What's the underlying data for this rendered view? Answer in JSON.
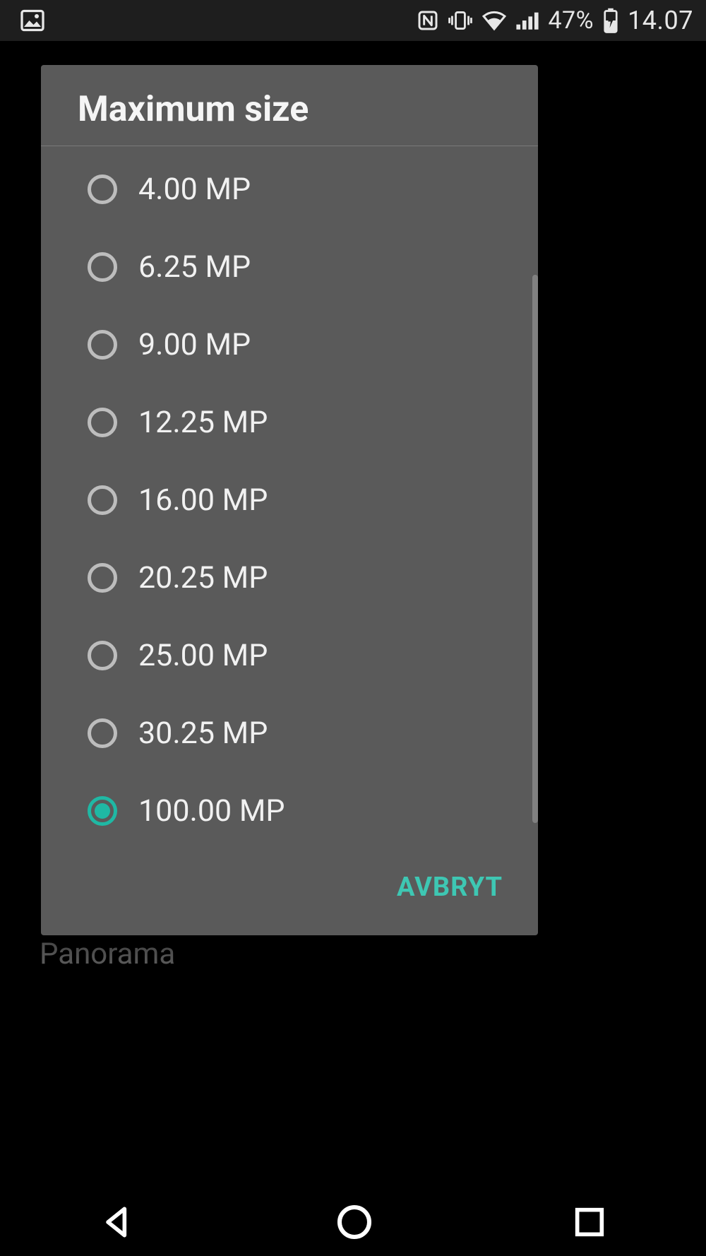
{
  "status_bar": {
    "battery_pct": "47%",
    "clock": "14.07",
    "icons": [
      "picture",
      "nfc",
      "vibrate",
      "wifi",
      "signal",
      "battery-charging"
    ]
  },
  "background": {
    "list_item_visible": "Panorama"
  },
  "dialog": {
    "title": "Maximum size",
    "options": [
      {
        "label": "4.00 MP",
        "selected": false
      },
      {
        "label": "6.25 MP",
        "selected": false
      },
      {
        "label": "9.00 MP",
        "selected": false
      },
      {
        "label": "12.25 MP",
        "selected": false
      },
      {
        "label": "16.00 MP",
        "selected": false
      },
      {
        "label": "20.25 MP",
        "selected": false
      },
      {
        "label": "25.00 MP",
        "selected": false
      },
      {
        "label": "30.25 MP",
        "selected": false
      },
      {
        "label": "100.00 MP",
        "selected": true
      }
    ],
    "cancel_label": "AVBRYT"
  },
  "colors": {
    "accent": "#1fb8a4",
    "dialog_bg": "#5a5a5a"
  }
}
